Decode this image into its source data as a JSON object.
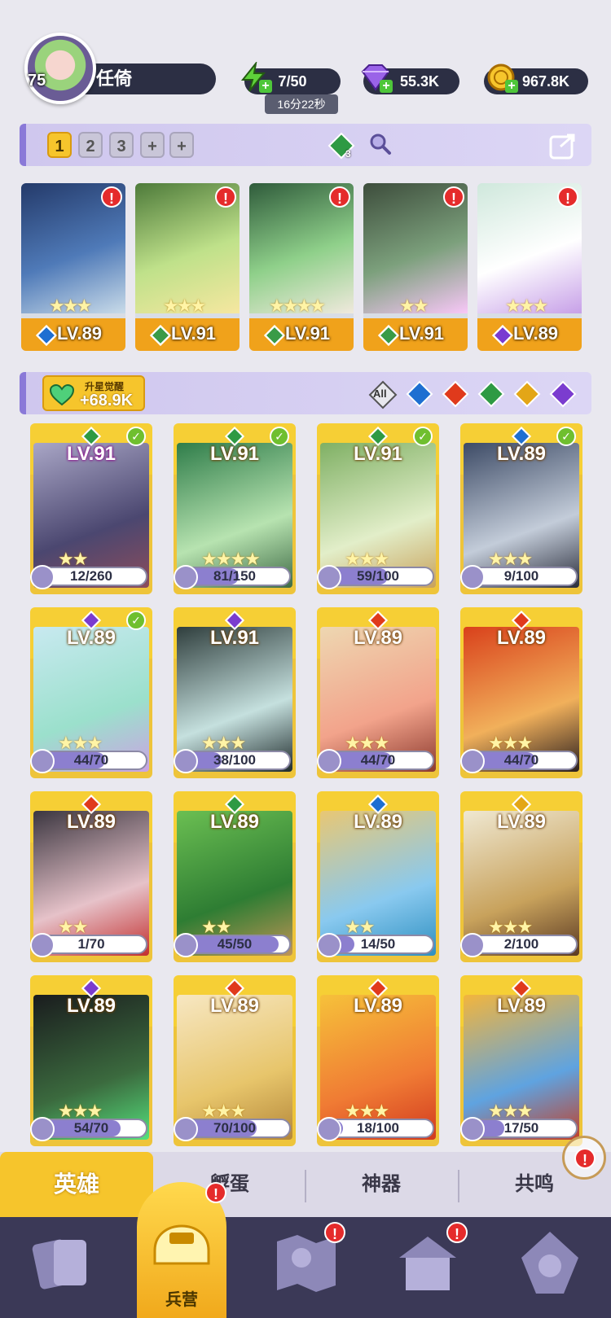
{
  "player": {
    "level": "75",
    "name": "任倚"
  },
  "resources": {
    "energy": "7/50",
    "energy_timer": "16分22秒",
    "gems": "55.3K",
    "gold": "967.8K"
  },
  "team_bar": {
    "tabs": [
      "1",
      "2",
      "3",
      "+",
      "+"
    ],
    "element_count": "3"
  },
  "lineup": [
    {
      "level": "LV.89",
      "element": "water",
      "stars": 3,
      "color": "#1e6fd1"
    },
    {
      "level": "LV.91",
      "element": "wood",
      "stars": 3,
      "color": "#3a9b47"
    },
    {
      "level": "LV.91",
      "element": "wood",
      "stars": 4,
      "color": "#3a9b47"
    },
    {
      "level": "LV.91",
      "element": "wood",
      "stars": 2,
      "color": "#3a9b47"
    },
    {
      "level": "LV.89",
      "element": "dark",
      "stars": 3,
      "color": "#7a3bd1"
    }
  ],
  "upgrade": {
    "title": "升星觉醒",
    "value": "+68.9K"
  },
  "filters": {
    "all": "All"
  },
  "heroes": [
    {
      "level": "LV.91",
      "progress": "12/260",
      "fill": 0.05,
      "elem": "wood",
      "stars": 2,
      "checked": true,
      "purple": true
    },
    {
      "level": "LV.91",
      "progress": "81/150",
      "fill": 0.54,
      "elem": "wood",
      "stars": 4,
      "checked": true
    },
    {
      "level": "LV.91",
      "progress": "59/100",
      "fill": 0.59,
      "elem": "wood",
      "stars": 3,
      "checked": true
    },
    {
      "level": "LV.89",
      "progress": "9/100",
      "fill": 0.09,
      "elem": "water",
      "stars": 3,
      "checked": true
    },
    {
      "level": "LV.89",
      "progress": "44/70",
      "fill": 0.63,
      "elem": "dark",
      "stars": 3,
      "checked": true
    },
    {
      "level": "LV.91",
      "progress": "38/100",
      "fill": 0.38,
      "elem": "dark",
      "stars": 3,
      "checked": false
    },
    {
      "level": "LV.89",
      "progress": "44/70",
      "fill": 0.63,
      "elem": "fire",
      "stars": 3,
      "checked": false
    },
    {
      "level": "LV.89",
      "progress": "44/70",
      "fill": 0.63,
      "elem": "fire",
      "stars": 3,
      "checked": false
    },
    {
      "level": "LV.89",
      "progress": "1/70",
      "fill": 0.01,
      "elem": "fire",
      "stars": 2,
      "checked": false
    },
    {
      "level": "LV.89",
      "progress": "45/50",
      "fill": 0.9,
      "elem": "wood",
      "stars": 2,
      "checked": false
    },
    {
      "level": "LV.89",
      "progress": "14/50",
      "fill": 0.28,
      "elem": "water",
      "stars": 2,
      "checked": false
    },
    {
      "level": "LV.89",
      "progress": "2/100",
      "fill": 0.02,
      "elem": "light",
      "stars": 3,
      "checked": false
    },
    {
      "level": "LV.89",
      "progress": "54/70",
      "fill": 0.77,
      "elem": "dark",
      "stars": 3,
      "checked": false
    },
    {
      "level": "LV.89",
      "progress": "70/100",
      "fill": 0.7,
      "elem": "fire",
      "stars": 3,
      "checked": false
    },
    {
      "level": "LV.89",
      "progress": "18/100",
      "fill": 0.18,
      "elem": "fire",
      "stars": 3,
      "checked": false
    },
    {
      "level": "LV.89",
      "progress": "17/50",
      "fill": 0.34,
      "elem": "fire",
      "stars": 3,
      "checked": false
    }
  ],
  "tabs": {
    "hero": "英雄",
    "hatch": "孵蛋",
    "artifact": "神器",
    "resonance": "共鸣"
  },
  "nav": {
    "barracks": "兵营"
  },
  "colors": {
    "water": "#1e6fd1",
    "fire": "#e03a1c",
    "wood": "#2e9a43",
    "light": "#e3a617",
    "dark": "#7b3ccf",
    "accent": "#f6c52c",
    "panel": "#2c2f44"
  }
}
